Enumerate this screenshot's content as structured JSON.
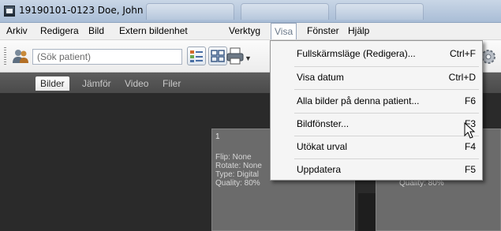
{
  "window": {
    "title": "19190101-0123 Doe, John"
  },
  "menubar": {
    "items": [
      "Arkiv",
      "Redigera",
      "Bild",
      "Extern bildenhet",
      "Verktyg",
      "Visa",
      "Fönster",
      "Hjälp"
    ],
    "open_index": 5
  },
  "toolbar": {
    "search_placeholder": "(Sök patient)",
    "icons": [
      "patient-icon",
      "list-view-icon",
      "grid-view-icon",
      "print-icon",
      "gear-icon"
    ]
  },
  "tabs": [
    "Bilder",
    "Jämför",
    "Video",
    "Filer"
  ],
  "active_tab": 0,
  "thumbnails": [
    {
      "number": "1",
      "meta": [
        "Flip: None",
        "Rotate: None",
        "Type: Digital",
        "Quality: 80%"
      ]
    },
    {
      "number": "",
      "meta": [
        "Quality: 80%"
      ]
    }
  ],
  "visa_menu": {
    "items": [
      {
        "label": "Fullskärmsläge (Redigera)...",
        "shortcut": "Ctrl+F"
      },
      {
        "label": "Visa datum",
        "shortcut": "Ctrl+D"
      },
      {
        "label": "Alla bilder på denna patient...",
        "shortcut": "F6"
      },
      {
        "label": "Bildfönster...",
        "shortcut": "F3"
      },
      {
        "label": "Utökat urval",
        "shortcut": "F4"
      },
      {
        "label": "Uppdatera",
        "shortcut": "F5"
      }
    ],
    "hovered_index": 3
  },
  "colors": {
    "titlebar": "#b9c9dd",
    "menu_background": "#f5f5f5",
    "content_background": "#2a2a2a",
    "thumbnail": "#6b6b6b"
  }
}
